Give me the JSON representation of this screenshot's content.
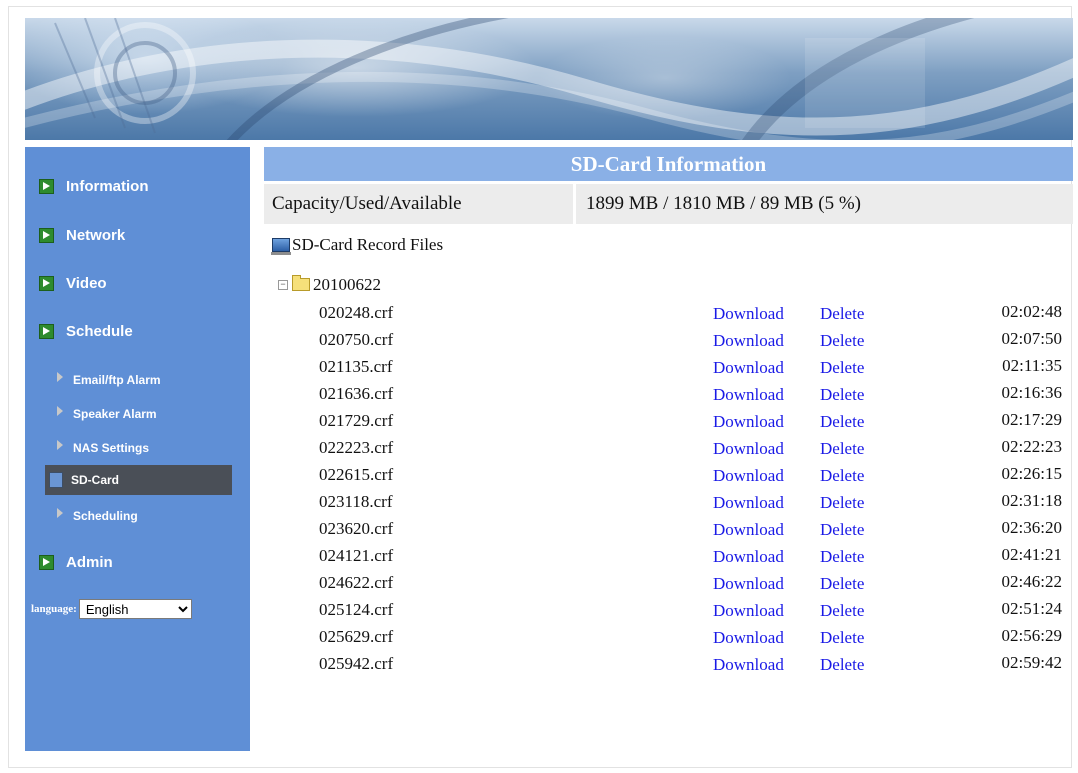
{
  "sidebar": {
    "main_items": [
      {
        "label": "Information"
      },
      {
        "label": "Network"
      },
      {
        "label": "Video"
      },
      {
        "label": "Schedule"
      },
      {
        "label": "Admin"
      }
    ],
    "sub_items": [
      {
        "label": "Email/ftp Alarm"
      },
      {
        "label": "Speaker Alarm"
      },
      {
        "label": "NAS Settings"
      },
      {
        "label": "SD-Card"
      },
      {
        "label": "Scheduling"
      }
    ],
    "language_label": "language:",
    "language_value": "English"
  },
  "main": {
    "title": "SD-Card Information",
    "capacity_label": "Capacity/Used/Available",
    "capacity_value": "1899 MB / 1810 MB / 89 MB (5 %)",
    "records_title": "SD-Card Record Files",
    "folder_name": "20100622",
    "download_label": "Download",
    "delete_label": "Delete",
    "files": [
      {
        "name": "020248.crf",
        "time": "02:02:48"
      },
      {
        "name": "020750.crf",
        "time": "02:07:50"
      },
      {
        "name": "021135.crf",
        "time": "02:11:35"
      },
      {
        "name": "021636.crf",
        "time": "02:16:36"
      },
      {
        "name": "021729.crf",
        "time": "02:17:29"
      },
      {
        "name": "022223.crf",
        "time": "02:22:23"
      },
      {
        "name": "022615.crf",
        "time": "02:26:15"
      },
      {
        "name": "023118.crf",
        "time": "02:31:18"
      },
      {
        "name": "023620.crf",
        "time": "02:36:20"
      },
      {
        "name": "024121.crf",
        "time": "02:41:21"
      },
      {
        "name": "024622.crf",
        "time": "02:46:22"
      },
      {
        "name": "025124.crf",
        "time": "02:51:24"
      },
      {
        "name": "025629.crf",
        "time": "02:56:29"
      },
      {
        "name": "025942.crf",
        "time": "02:59:42"
      }
    ]
  },
  "colors": {
    "sidebar_bg": "#5f8fd6",
    "title_bar_bg": "#8ab0e6",
    "link": "#1a1ae6",
    "active_item_bg": "#4a4f57"
  }
}
